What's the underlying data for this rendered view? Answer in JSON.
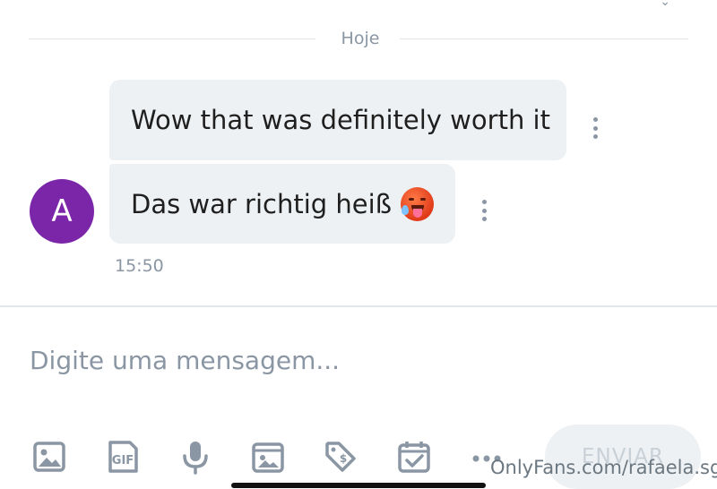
{
  "date_divider": {
    "label": "Hoje"
  },
  "messages": [
    {
      "text": "Wow that was definitely worth it",
      "emoji": ""
    },
    {
      "text": "Das war richtig heiß",
      "emoji": "hot-face-emoji"
    }
  ],
  "avatar": {
    "initial": "A",
    "color": "#7b26a8"
  },
  "timestamp": "15:50",
  "composer": {
    "placeholder": "Digite uma mensagem..."
  },
  "toolbar": {
    "icons": [
      "image-icon",
      "gif-icon",
      "microphone-icon",
      "media-vault-icon",
      "price-tag-icon",
      "schedule-calendar-icon",
      "more-icon"
    ],
    "gif_label": "GIF",
    "send_label": "ENVIAR"
  },
  "watermark": "OnlyFans.com/rafaela.sg",
  "colors": {
    "accent_icon": "#8a96a3",
    "bubble": "#eef1f3",
    "avatar": "#7b26a8"
  }
}
